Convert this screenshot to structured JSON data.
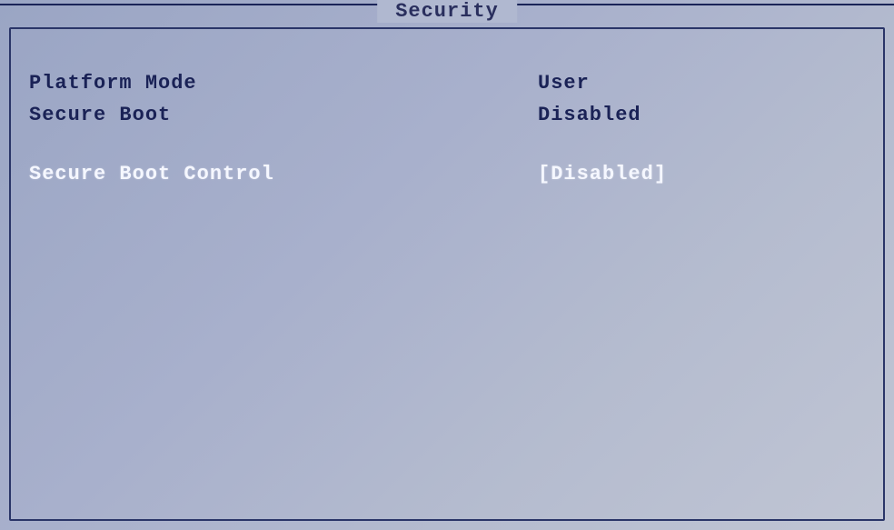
{
  "tab": {
    "label": "Security"
  },
  "rows": {
    "platform_mode": {
      "label": "Platform Mode",
      "value": "User"
    },
    "secure_boot": {
      "label": "Secure Boot",
      "value": "Disabled"
    },
    "secure_boot_control": {
      "label": "Secure Boot Control",
      "value": "Disabled"
    }
  }
}
